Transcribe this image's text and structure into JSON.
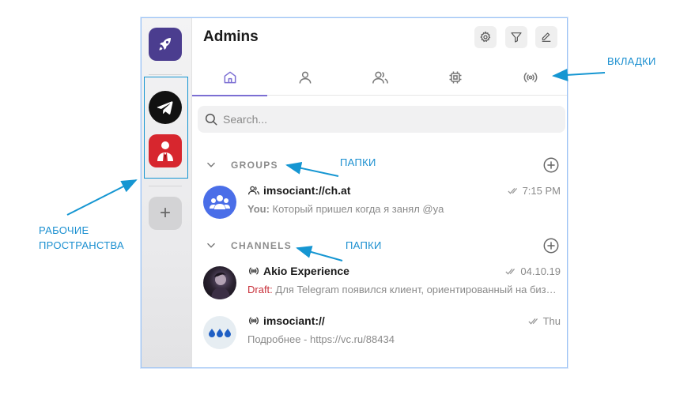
{
  "header": {
    "title": "Admins"
  },
  "tabs": [
    {
      "name": "home",
      "icon": "home-icon"
    },
    {
      "name": "person",
      "icon": "user-icon"
    },
    {
      "name": "group",
      "icon": "users-icon"
    },
    {
      "name": "bot",
      "icon": "chip-icon"
    },
    {
      "name": "channel",
      "icon": "broadcast-icon"
    }
  ],
  "search": {
    "placeholder": "Search..."
  },
  "folders": [
    {
      "name": "GROUPS"
    },
    {
      "name": "CHANNELS"
    }
  ],
  "chats": [
    {
      "name": "imsociant://ch.at",
      "time": "7:15 PM",
      "prefix": "You:",
      "preview": " Который пришел когда я занял @ya"
    },
    {
      "name": "Akio Experience",
      "time": "04.10.19",
      "prefix": "Draft:",
      "preview": " Для Telegram появился клиент, ориентированный на бизнес"
    },
    {
      "name": "imsociant://",
      "time": "Thu",
      "prefix": "",
      "preview": "Подробнее - https://vc.ru/88434"
    }
  ],
  "rail": {
    "add_label": "+"
  },
  "annotations": {
    "tabs": "ВКЛАДКИ",
    "folders_1": "ПАПКИ",
    "folders_2": "ПАПКИ",
    "workspaces_line1": "РАБОЧИЕ",
    "workspaces_line2": "ПРОСТРАНСТВА"
  },
  "colors": {
    "accent": "#7c6fd3",
    "annotation": "#1a8fd0",
    "draft": "#c8303a",
    "tg_red": "#d7262e"
  }
}
